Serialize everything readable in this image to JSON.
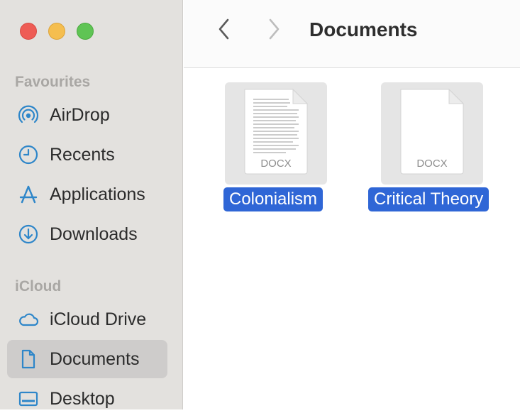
{
  "window": {
    "title": "Documents"
  },
  "sidebar": {
    "sections": [
      {
        "title": "Favourites"
      },
      {
        "title": "iCloud"
      }
    ],
    "items": [
      {
        "label": "AirDrop",
        "icon": "airdrop-icon"
      },
      {
        "label": "Recents",
        "icon": "clock-icon"
      },
      {
        "label": "Applications",
        "icon": "applications-icon"
      },
      {
        "label": "Downloads",
        "icon": "download-icon"
      },
      {
        "label": "iCloud Drive",
        "icon": "cloud-icon"
      },
      {
        "label": "Documents",
        "icon": "document-icon",
        "selected": true
      },
      {
        "label": "Desktop",
        "icon": "desktop-icon"
      }
    ]
  },
  "files": [
    {
      "name": "Colonialism",
      "type": "DOCX",
      "selected": true,
      "has_preview_text": true
    },
    {
      "name": "Critical Theory",
      "type": "DOCX",
      "selected": true,
      "has_preview_text": false
    }
  ],
  "colors": {
    "accent": "#2f66d6",
    "sidebar_icon": "#2e86c9",
    "sidebar_bg": "#e3e1de",
    "selection_bg": "#cecccb"
  }
}
